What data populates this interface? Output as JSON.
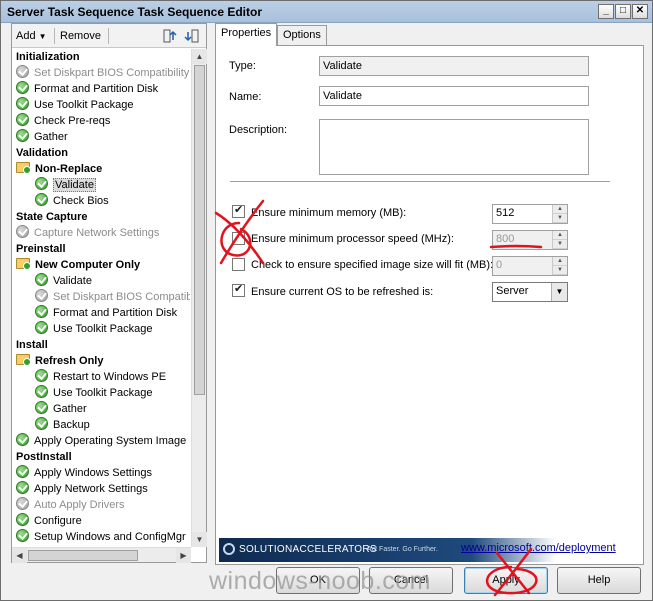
{
  "window": {
    "title": "Server Task Sequence Task Sequence Editor",
    "controls": [
      "minimize",
      "maximize",
      "close"
    ]
  },
  "toolbar": {
    "add_label": "Add",
    "remove_label": "Remove"
  },
  "tree": [
    {
      "label": "Initialization",
      "kind": "group"
    },
    {
      "label": "Set Diskpart BIOS Compatibility M",
      "kind": "step",
      "icon": "gray-check-icon",
      "indent": 1
    },
    {
      "label": "Format and Partition Disk",
      "kind": "step",
      "icon": "green-check-icon",
      "indent": 1
    },
    {
      "label": "Use Toolkit Package",
      "kind": "step",
      "icon": "green-check-icon",
      "indent": 1
    },
    {
      "label": "Check Pre-reqs",
      "kind": "step",
      "icon": "green-check-icon",
      "indent": 1
    },
    {
      "label": "Gather",
      "kind": "step",
      "icon": "green-check-icon",
      "indent": 1
    },
    {
      "label": "Validation",
      "kind": "group"
    },
    {
      "label": "Non-Replace",
      "kind": "folder",
      "icon": "folder-icon",
      "indent": 1
    },
    {
      "label": "Validate",
      "kind": "step",
      "icon": "green-check-icon",
      "indent": 2,
      "selected": true
    },
    {
      "label": "Check Bios",
      "kind": "step",
      "icon": "green-check-icon",
      "indent": 2
    },
    {
      "label": "State Capture",
      "kind": "group"
    },
    {
      "label": "Capture Network Settings",
      "kind": "step",
      "icon": "gray-check-icon",
      "indent": 1
    },
    {
      "label": "Preinstall",
      "kind": "group"
    },
    {
      "label": "New Computer Only",
      "kind": "folder",
      "icon": "folder-icon",
      "indent": 1
    },
    {
      "label": "Validate",
      "kind": "step",
      "icon": "green-check-icon",
      "indent": 2
    },
    {
      "label": "Set Diskpart BIOS Compatibi",
      "kind": "step",
      "icon": "gray-check-icon",
      "indent": 2
    },
    {
      "label": "Format and Partition Disk",
      "kind": "step",
      "icon": "green-check-icon",
      "indent": 2
    },
    {
      "label": "Use Toolkit Package",
      "kind": "step",
      "icon": "green-check-icon",
      "indent": 2
    },
    {
      "label": "Install",
      "kind": "group"
    },
    {
      "label": "Refresh Only",
      "kind": "folder",
      "icon": "folder-icon",
      "indent": 1
    },
    {
      "label": "Restart to Windows PE",
      "kind": "step",
      "icon": "green-check-icon",
      "indent": 2
    },
    {
      "label": "Use Toolkit Package",
      "kind": "step",
      "icon": "green-check-icon",
      "indent": 2
    },
    {
      "label": "Gather",
      "kind": "step",
      "icon": "green-check-icon",
      "indent": 2
    },
    {
      "label": "Backup",
      "kind": "step",
      "icon": "green-check-icon",
      "indent": 2
    },
    {
      "label": "Apply Operating System Image",
      "kind": "step",
      "icon": "green-check-icon",
      "indent": 1
    },
    {
      "label": "PostInstall",
      "kind": "group"
    },
    {
      "label": "Apply Windows Settings",
      "kind": "step",
      "icon": "green-check-icon",
      "indent": 1
    },
    {
      "label": "Apply Network Settings",
      "kind": "step",
      "icon": "green-check-icon",
      "indent": 1
    },
    {
      "label": "Auto Apply Drivers",
      "kind": "step",
      "icon": "gray-check-icon",
      "indent": 1
    },
    {
      "label": "Configure",
      "kind": "step",
      "icon": "green-check-icon",
      "indent": 1
    },
    {
      "label": "Setup Windows and ConfigMgr",
      "kind": "step",
      "icon": "green-check-icon",
      "indent": 1
    }
  ],
  "tabs": [
    {
      "label": "Properties",
      "active": true
    },
    {
      "label": "Options",
      "active": false
    }
  ],
  "properties": {
    "type_label": "Type:",
    "type_value": "Validate",
    "name_label": "Name:",
    "name_value": "Validate",
    "description_label": "Description:",
    "description_value": "",
    "checks": [
      {
        "label": "Ensure minimum memory (MB):",
        "checked": true,
        "control": "spin",
        "value": "512",
        "enabled": true
      },
      {
        "label": "Ensure minimum processor speed (MHz):",
        "checked": false,
        "control": "spin",
        "value": "800",
        "enabled": false
      },
      {
        "label": "Check to ensure specified image size will fit (MB):",
        "checked": false,
        "control": "spin",
        "value": "0",
        "enabled": false
      },
      {
        "label": "Ensure current OS to be refreshed is:",
        "checked": true,
        "control": "select",
        "value": "Server",
        "enabled": true
      }
    ]
  },
  "banner": {
    "brand": "SOLUTIONACCELERATORS",
    "tagline": "Act Faster. Go Further.",
    "link": "www.microsoft.com/deployment"
  },
  "buttons": {
    "ok": "OK",
    "cancel": "Cancel",
    "apply": "Apply",
    "help": "Help"
  },
  "watermark": "windows-noob.com",
  "colors": {
    "annotation_red": "#e0141e",
    "banner_blue": "#1f4a7d",
    "link_blue": "#00009c"
  }
}
